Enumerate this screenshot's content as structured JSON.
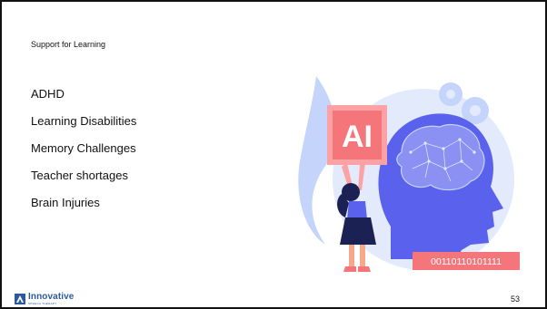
{
  "slide": {
    "title": "Support for Learning",
    "bullets": [
      "ADHD",
      "Learning Disabilities",
      "Memory Challenges",
      "Teacher shortages",
      "Brain Injuries"
    ],
    "page_number": "53"
  },
  "illustration": {
    "ai_label": "AI",
    "binary_text": "00110110101111"
  },
  "footer": {
    "logo_text": "Innovative",
    "logo_subtext": "SPEECH THERAPY"
  },
  "colors": {
    "primary_blue": "#5a61ec",
    "light_blue": "#c5d4fb",
    "pale_blue": "#e3eafc",
    "coral": "#f5767a",
    "coral_light": "#fca2a4",
    "navy": "#1c2154",
    "logo_blue": "#2d5a9a"
  }
}
